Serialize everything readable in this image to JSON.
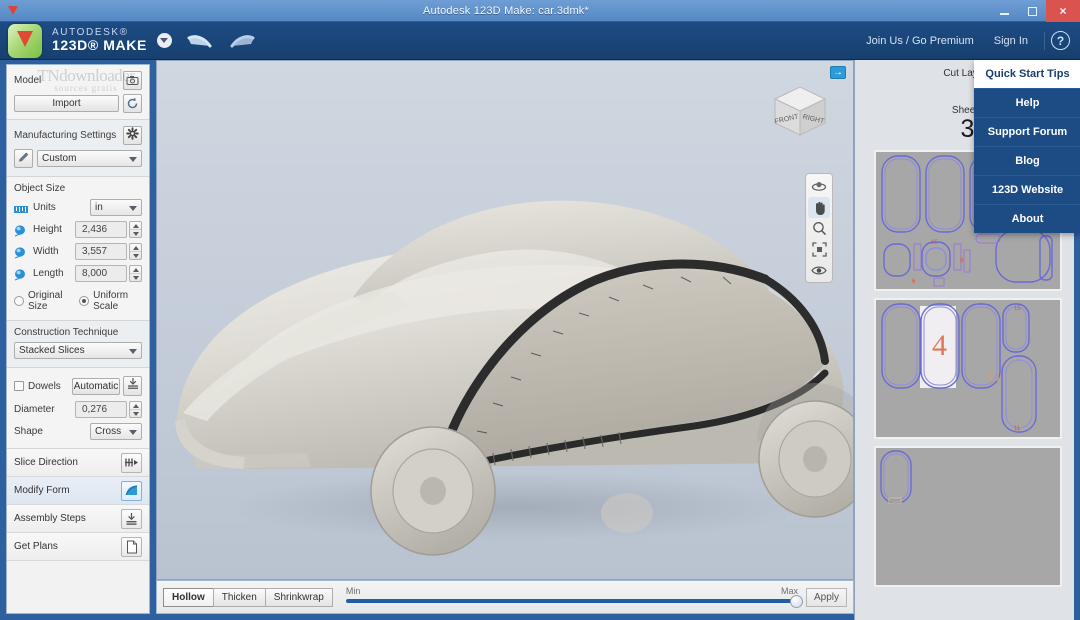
{
  "window": {
    "title": "Autodesk 123D Make: car.3dmk*",
    "minimize_label": "Minimize",
    "maximize_label": "Maximize",
    "close_label": "×"
  },
  "appbar": {
    "brand_line1": "AUTODESK®",
    "brand_line2": "123D® MAKE",
    "undo_label": "Undo",
    "redo_label": "Redo",
    "join_label": "Join Us / Go Premium",
    "signin_label": "Sign In",
    "help_label": "?"
  },
  "left_panel": {
    "watermark_line1": "TNdownloader",
    "watermark_line2": "sources gratis",
    "model": {
      "title": "Model",
      "import_label": "Import",
      "refresh_icon": "refresh-icon",
      "camera_icon": "camera-icon"
    },
    "manufacturing": {
      "title": "Manufacturing Settings",
      "gear_icon": "gear-icon",
      "edit_icon": "pencil-icon",
      "preset_value": "Custom"
    },
    "object_size": {
      "title": "Object Size",
      "units_label": "Units",
      "units_value": "in",
      "height_label": "Height",
      "height_value": "2,436",
      "width_label": "Width",
      "width_value": "3,557",
      "length_label": "Length",
      "length_value": "8,000",
      "original_size_label": "Original Size",
      "uniform_scale_label": "Uniform Scale"
    },
    "construction": {
      "title": "Construction Technique",
      "value": "Stacked Slices"
    },
    "dowels": {
      "label": "Dowels",
      "mode_value": "Automatic",
      "diameter_label": "Diameter",
      "diameter_value": "0,276",
      "shape_label": "Shape",
      "shape_value": "Cross"
    },
    "tasks": [
      {
        "label": "Slice Direction",
        "icon": "slice-direction-icon",
        "active": false
      },
      {
        "label": "Modify Form",
        "icon": "modify-form-icon",
        "active": true
      },
      {
        "label": "Assembly Steps",
        "icon": "assembly-steps-icon",
        "active": false
      },
      {
        "label": "Get Plans",
        "icon": "get-plans-icon",
        "active": false
      }
    ]
  },
  "viewport": {
    "viewcube_front": "FRONT",
    "viewcube_right": "RIGHT",
    "nav_tools": [
      {
        "name": "orbit-icon",
        "label": "Orbit",
        "active": false
      },
      {
        "name": "pan-hand-icon",
        "label": "Pan",
        "active": true
      },
      {
        "name": "zoom-magnifier-icon",
        "label": "Zoom",
        "active": false
      },
      {
        "name": "fit-to-window-icon",
        "label": "Fit",
        "active": false
      },
      {
        "name": "eye-visibility-icon",
        "label": "Visibility",
        "active": false
      }
    ],
    "collapse_label": "→"
  },
  "bottom_bar": {
    "modes": [
      {
        "label": "Hollow",
        "active": true
      },
      {
        "label": "Thicken",
        "active": false
      },
      {
        "label": "Shrinkwrap",
        "active": false
      }
    ],
    "slider_min_label": "Min",
    "slider_max_label": "Max",
    "slider_value": 100,
    "apply_label": "Apply"
  },
  "right_panel": {
    "cut_layout_title": "Cut Layout",
    "sheets_label": "Sheets",
    "sheets_count": "3",
    "menu": {
      "header": "Quick Start Tips",
      "items": [
        "Help",
        "Support Forum",
        "Blog",
        "123D Website",
        "About"
      ]
    },
    "sheet_labels": [
      "4",
      "11",
      "15"
    ]
  },
  "colors": {
    "chrome_blue": "#2e5f9e",
    "appbar_blue": "#1d4b84",
    "menu_blue": "#1d4b84",
    "accent_cyan": "#2e9ad6",
    "close_red": "#d9534f",
    "sheet_gray": "#a7a7a7",
    "cut_outline": "#6a6ad6",
    "slider_blue": "#1f5fa8"
  }
}
